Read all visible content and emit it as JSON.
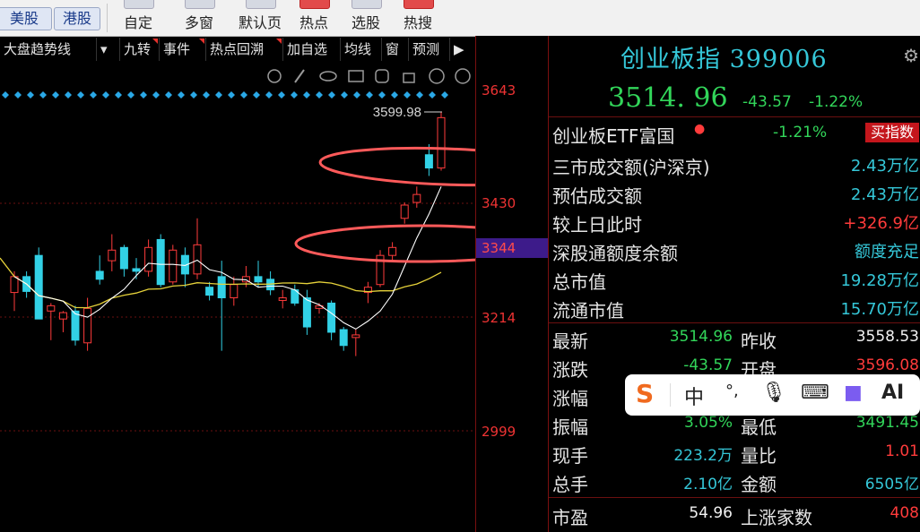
{
  "toolbar": {
    "tabs": [
      "美股",
      "港股"
    ],
    "items": [
      "自定",
      "多窗",
      "默认页",
      "热点",
      "选股",
      "热搜"
    ]
  },
  "chart_toolbar": {
    "items": [
      "大盘趋势线",
      "九转",
      "事件",
      "热点回溯",
      "加自选",
      "均线",
      "窗",
      "预测"
    ],
    "dropdown_icon": "triangle-down-icon",
    "expand_icon": "play-end-icon"
  },
  "chart": {
    "high_label": "3599.98",
    "y_ticks": [
      "3643",
      "3430",
      "3344",
      "3214",
      "2999"
    ],
    "current_level": "3344"
  },
  "chart_data": {
    "type": "candlestick",
    "y_ticks": [
      3643,
      3430,
      3344,
      3214,
      2999
    ],
    "annotations": [
      "3599.98"
    ],
    "candles": [
      {
        "o": 3260,
        "h": 3300,
        "l": 3225,
        "c": 3290
      },
      {
        "o": 3290,
        "h": 3300,
        "l": 3250,
        "c": 3262
      },
      {
        "o": 3330,
        "h": 3345,
        "l": 3210,
        "c": 3210
      },
      {
        "o": 3225,
        "h": 3240,
        "l": 3170,
        "c": 3235
      },
      {
        "o": 3210,
        "h": 3225,
        "l": 3185,
        "c": 3222
      },
      {
        "o": 3225,
        "h": 3235,
        "l": 3160,
        "c": 3170
      },
      {
        "o": 3165,
        "h": 3250,
        "l": 3150,
        "c": 3230
      },
      {
        "o": 3300,
        "h": 3330,
        "l": 3275,
        "c": 3285
      },
      {
        "o": 3320,
        "h": 3370,
        "l": 3300,
        "c": 3340
      },
      {
        "o": 3345,
        "h": 3350,
        "l": 3290,
        "c": 3305
      },
      {
        "o": 3305,
        "h": 3325,
        "l": 3285,
        "c": 3300
      },
      {
        "o": 3300,
        "h": 3360,
        "l": 3290,
        "c": 3345
      },
      {
        "o": 3360,
        "h": 3370,
        "l": 3270,
        "c": 3275
      },
      {
        "o": 3280,
        "h": 3350,
        "l": 3275,
        "c": 3340
      },
      {
        "o": 3330,
        "h": 3345,
        "l": 3270,
        "c": 3295
      },
      {
        "o": 3295,
        "h": 3400,
        "l": 3285,
        "c": 3350
      },
      {
        "o": 3270,
        "h": 3280,
        "l": 3245,
        "c": 3255
      },
      {
        "o": 3290,
        "h": 3320,
        "l": 3150,
        "c": 3250
      },
      {
        "o": 3250,
        "h": 3290,
        "l": 3235,
        "c": 3275
      },
      {
        "o": 3280,
        "h": 3310,
        "l": 3270,
        "c": 3290
      },
      {
        "o": 3290,
        "h": 3320,
        "l": 3270,
        "c": 3280
      },
      {
        "o": 3285,
        "h": 3300,
        "l": 3255,
        "c": 3265
      },
      {
        "o": 3245,
        "h": 3265,
        "l": 3230,
        "c": 3250
      },
      {
        "o": 3265,
        "h": 3275,
        "l": 3235,
        "c": 3240
      },
      {
        "o": 3250,
        "h": 3265,
        "l": 3180,
        "c": 3195
      },
      {
        "o": 3230,
        "h": 3240,
        "l": 3220,
        "c": 3235
      },
      {
        "o": 3240,
        "h": 3245,
        "l": 3170,
        "c": 3185
      },
      {
        "o": 3190,
        "h": 3195,
        "l": 3150,
        "c": 3160
      },
      {
        "o": 3175,
        "h": 3190,
        "l": 3140,
        "c": 3180
      },
      {
        "o": 3260,
        "h": 3280,
        "l": 3240,
        "c": 3270
      },
      {
        "o": 3275,
        "h": 3340,
        "l": 3270,
        "c": 3330
      },
      {
        "o": 3330,
        "h": 3355,
        "l": 3320,
        "c": 3345
      },
      {
        "o": 3400,
        "h": 3430,
        "l": 3390,
        "c": 3425
      },
      {
        "o": 3430,
        "h": 3460,
        "l": 3420,
        "c": 3445
      },
      {
        "o": 3520,
        "h": 3540,
        "l": 3480,
        "c": 3495
      },
      {
        "o": 3495,
        "h": 3600,
        "l": 3490,
        "c": 3590
      }
    ]
  },
  "panel": {
    "title": "创业板指 399006",
    "price": "3514. 96",
    "change": "-43.57",
    "change_pct": "-1.22%",
    "etf_label": "创业板ETF富国",
    "etf_pct": "-1.21%",
    "buy_label": "买指数",
    "info_rows": [
      {
        "label": "三市成交额(沪深京)",
        "value": "2.43万亿"
      },
      {
        "label": "预估成交额",
        "value": "2.43万亿"
      },
      {
        "label": "较上日此时",
        "value": "+326.9亿"
      },
      {
        "label": "深股通额度余额",
        "value": "额度充足"
      },
      {
        "label": "总市值",
        "value": "19.28万亿"
      },
      {
        "label": "流通市值",
        "value": "15.70万亿"
      }
    ],
    "quote_rows": [
      {
        "l1": "最新",
        "v1": "3514.96",
        "l2": "昨收",
        "v2": "3558.53"
      },
      {
        "l1": "涨跌",
        "v1": "-43.57",
        "l2": "开盘",
        "v2": "3596.08"
      },
      {
        "l1": "涨幅",
        "v1": "",
        "l2": "",
        "v2": ""
      },
      {
        "l1": "振幅",
        "v1": "3.05%",
        "l2": "最低",
        "v2": "3491.45"
      },
      {
        "l1": "现手",
        "v1": "223.2万",
        "l2": "量比",
        "v2": "1.01"
      },
      {
        "l1": "总手",
        "v1": "2.10亿",
        "l2": "金额",
        "v2": "6505亿"
      },
      {
        "l1": "市盈",
        "v1": "54.96",
        "l2": "上涨家数",
        "v2": "408"
      }
    ]
  },
  "ime": {
    "items": [
      "中",
      "°,",
      "AI"
    ]
  },
  "colors": {
    "up": "#ff3b3b",
    "down": "#32d1e6",
    "ma_fast": "#ffffff",
    "ma_slow": "#e6d23a",
    "annotation": "#ff5a5a"
  }
}
